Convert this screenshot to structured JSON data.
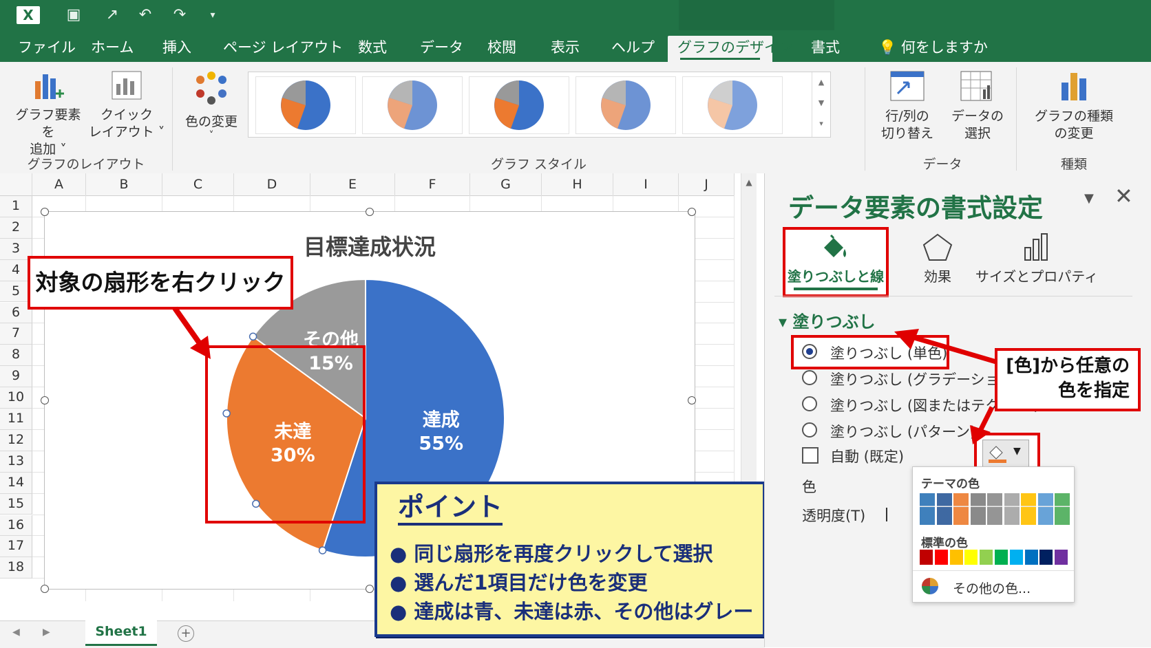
{
  "ribbon_tabs": [
    "ファイル",
    "ホーム",
    "挿入",
    "ページ レイアウト",
    "数式",
    "データ",
    "校閲",
    "表示",
    "ヘルプ",
    "グラフのデザイン",
    "書式"
  ],
  "tell_me": "何をしますか",
  "ribbon": {
    "add_element": [
      "グラフ要素を",
      "追加 ˅"
    ],
    "quick_layout": [
      "クイック",
      "レイアウト ˅"
    ],
    "group_layout": "グラフのレイアウト",
    "change_color": [
      "色の変更",
      "˅"
    ],
    "group_styles": "グラフ スタイル",
    "switch_row_col": [
      "行/列の",
      "切り替え"
    ],
    "select_data": [
      "データの",
      "選択"
    ],
    "group_data": "データ",
    "change_type": [
      "グラフの種類",
      "の変更"
    ],
    "group_type": "種類"
  },
  "columns": [
    "A",
    "B",
    "C",
    "D",
    "E",
    "F",
    "G",
    "H",
    "I",
    "J"
  ],
  "rows": [
    "1",
    "2",
    "3",
    "4",
    "5",
    "6",
    "7",
    "8",
    "9",
    "10",
    "11",
    "12",
    "13",
    "14",
    "15",
    "16",
    "17",
    "18"
  ],
  "sheet_tab": "Sheet1",
  "chart_data": {
    "type": "pie",
    "title": "目標達成状況",
    "categories": [
      "達成",
      "未達",
      "その他"
    ],
    "values": [
      55,
      30,
      15
    ],
    "labels": [
      "55%",
      "30%",
      "15%"
    ],
    "colors": [
      "#3b72c8",
      "#ec7a30",
      "#9a9a9a"
    ]
  },
  "callout_right_click": "対象の扇形を右クリック",
  "point": {
    "title": "ポイント",
    "items": [
      "同じ扇形を再度クリックして選択",
      "選んだ1項目だけ色を変更",
      "達成は青、未達は赤、その他はグレー"
    ]
  },
  "pane": {
    "title": "データ要素の書式設定",
    "tabs": [
      "塗りつぶしと線",
      "効果",
      "サイズとプロパティ"
    ],
    "section": "塗りつぶし",
    "options": [
      "塗りつぶし (単色)",
      "塗りつぶし (グラデーション)",
      "塗りつぶし (図またはテクスチャ",
      "塗りつぶし (パターン)"
    ],
    "auto": "自動 (既定)",
    "color_label": "色",
    "transparency": "透明度(T)",
    "callout": [
      "[色]から任意の",
      "色を指定"
    ]
  },
  "palette": {
    "theme_label": "テーマの色",
    "theme_colors": [
      "#2e75b6",
      "#2e5c9a",
      "#ed7d31",
      "#808080",
      "#8c8c8c",
      "#a5a5a5",
      "#ffc000",
      "#5b9bd5",
      "#4ead5b"
    ],
    "standard_label": "標準の色",
    "standard_colors": [
      "#c00000",
      "#ff0000",
      "#ffc000",
      "#ffff00",
      "#92d050",
      "#00b050",
      "#00b0f0",
      "#0070c0",
      "#002060",
      "#7030a0"
    ],
    "more": "その他の色..."
  }
}
